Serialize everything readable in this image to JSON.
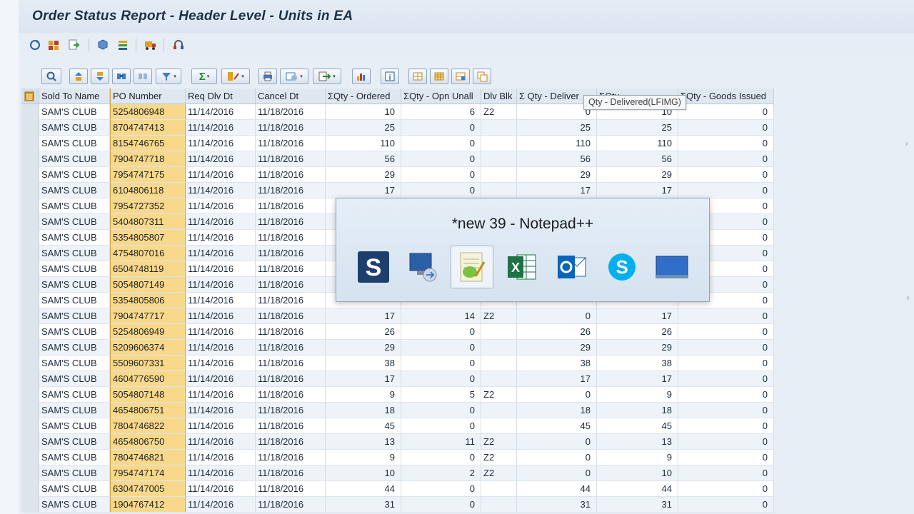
{
  "title": "Order Status Report - Header Level  - Units in EA",
  "app_toolbar_icons": [
    "refresh-icon",
    "chart-icon",
    "export-icon",
    "cube-icon",
    "layers-icon",
    "transport-icon",
    "headset-icon"
  ],
  "alv_toolbar_icons": [
    "details-icon",
    "sort-ascending-icon",
    "sort-descending-icon",
    "find-icon",
    "find-next-icon",
    "filter-icon",
    "sum-icon",
    "subtotal-icon",
    "print-icon",
    "views-icon",
    "export-icon",
    "chart-icon",
    "info-icon",
    "layout-select-icon",
    "layout-grid-icon",
    "layout-save-icon",
    "layout-manage-icon"
  ],
  "columns": [
    "Sold To Name",
    "PO Number",
    "Req Dlv Dt",
    "Cancel Dt",
    "ΣQty - Ordered",
    "ΣQty - Opn Unall",
    "Dlv Blk",
    "Σ Qty - Deliver",
    "ΣQty - ...",
    "ΣQty - Goods Issued"
  ],
  "rows": [
    {
      "sold_to": "SAM'S CLUB",
      "po": "5254806948",
      "req": "11/14/2016",
      "cancel": "11/18/2016",
      "ordered": "10",
      "open": "6",
      "blk": "Z2",
      "delivered": "0",
      "col9": "10",
      "gi": "0"
    },
    {
      "sold_to": "SAM'S CLUB",
      "po": "8704747413",
      "req": "11/14/2016",
      "cancel": "11/18/2016",
      "ordered": "25",
      "open": "0",
      "blk": "",
      "delivered": "25",
      "col9": "25",
      "gi": "0"
    },
    {
      "sold_to": "SAM'S CLUB",
      "po": "8154746765",
      "req": "11/14/2016",
      "cancel": "11/18/2016",
      "ordered": "110",
      "open": "0",
      "blk": "",
      "delivered": "110",
      "col9": "110",
      "gi": "0"
    },
    {
      "sold_to": "SAM'S CLUB",
      "po": "7904747718",
      "req": "11/14/2016",
      "cancel": "11/18/2016",
      "ordered": "56",
      "open": "0",
      "blk": "",
      "delivered": "56",
      "col9": "56",
      "gi": "0"
    },
    {
      "sold_to": "SAM'S CLUB",
      "po": "7954747175",
      "req": "11/14/2016",
      "cancel": "11/18/2016",
      "ordered": "29",
      "open": "0",
      "blk": "",
      "delivered": "29",
      "col9": "29",
      "gi": "0"
    },
    {
      "sold_to": "SAM'S CLUB",
      "po": "6104806118",
      "req": "11/14/2016",
      "cancel": "11/18/2016",
      "ordered": "17",
      "open": "0",
      "blk": "",
      "delivered": "17",
      "col9": "17",
      "gi": "0"
    },
    {
      "sold_to": "SAM'S CLUB",
      "po": "7954727352",
      "req": "11/14/2016",
      "cancel": "11/18/2016",
      "ordered": "",
      "open": "",
      "blk": "",
      "delivered": "",
      "col9": "",
      "gi": "0"
    },
    {
      "sold_to": "SAM'S CLUB",
      "po": "5404807311",
      "req": "11/14/2016",
      "cancel": "11/18/2016",
      "ordered": "",
      "open": "",
      "blk": "",
      "delivered": "",
      "col9": "",
      "gi": "0"
    },
    {
      "sold_to": "SAM'S CLUB",
      "po": "5354805807",
      "req": "11/14/2016",
      "cancel": "11/18/2016",
      "ordered": "",
      "open": "",
      "blk": "",
      "delivered": "",
      "col9": "",
      "gi": "0"
    },
    {
      "sold_to": "SAM'S CLUB",
      "po": "4754807016",
      "req": "11/14/2016",
      "cancel": "11/18/2016",
      "ordered": "",
      "open": "",
      "blk": "",
      "delivered": "",
      "col9": "",
      "gi": "0"
    },
    {
      "sold_to": "SAM'S CLUB",
      "po": "6504748119",
      "req": "11/14/2016",
      "cancel": "11/18/2016",
      "ordered": "",
      "open": "",
      "blk": "",
      "delivered": "",
      "col9": "",
      "gi": "0"
    },
    {
      "sold_to": "SAM'S CLUB",
      "po": "5054807149",
      "req": "11/14/2016",
      "cancel": "11/18/2016",
      "ordered": "",
      "open": "",
      "blk": "",
      "delivered": "",
      "col9": "",
      "gi": "0"
    },
    {
      "sold_to": "SAM'S CLUB",
      "po": "5354805806",
      "req": "11/14/2016",
      "cancel": "11/18/2016",
      "ordered": "",
      "open": "",
      "blk": "",
      "delivered": "",
      "col9": "",
      "gi": "0"
    },
    {
      "sold_to": "SAM'S CLUB",
      "po": "7904747717",
      "req": "11/14/2016",
      "cancel": "11/18/2016",
      "ordered": "17",
      "open": "14",
      "blk": "Z2",
      "delivered": "0",
      "col9": "17",
      "gi": "0"
    },
    {
      "sold_to": "SAM'S CLUB",
      "po": "5254806949",
      "req": "11/14/2016",
      "cancel": "11/18/2016",
      "ordered": "26",
      "open": "0",
      "blk": "",
      "delivered": "26",
      "col9": "26",
      "gi": "0"
    },
    {
      "sold_to": "SAM'S CLUB",
      "po": "5209606374",
      "req": "11/14/2016",
      "cancel": "11/18/2016",
      "ordered": "29",
      "open": "0",
      "blk": "",
      "delivered": "29",
      "col9": "29",
      "gi": "0"
    },
    {
      "sold_to": "SAM'S CLUB",
      "po": "5509607331",
      "req": "11/14/2016",
      "cancel": "11/18/2016",
      "ordered": "38",
      "open": "0",
      "blk": "",
      "delivered": "38",
      "col9": "38",
      "gi": "0"
    },
    {
      "sold_to": "SAM'S CLUB",
      "po": "4604776590",
      "req": "11/14/2016",
      "cancel": "11/18/2016",
      "ordered": "17",
      "open": "0",
      "blk": "",
      "delivered": "17",
      "col9": "17",
      "gi": "0"
    },
    {
      "sold_to": "SAM'S CLUB",
      "po": "5054807148",
      "req": "11/14/2016",
      "cancel": "11/18/2016",
      "ordered": "9",
      "open": "5",
      "blk": "Z2",
      "delivered": "0",
      "col9": "9",
      "gi": "0"
    },
    {
      "sold_to": "SAM'S CLUB",
      "po": "4654806751",
      "req": "11/14/2016",
      "cancel": "11/18/2016",
      "ordered": "18",
      "open": "0",
      "blk": "",
      "delivered": "18",
      "col9": "18",
      "gi": "0"
    },
    {
      "sold_to": "SAM'S CLUB",
      "po": "7804746822",
      "req": "11/14/2016",
      "cancel": "11/18/2016",
      "ordered": "45",
      "open": "0",
      "blk": "",
      "delivered": "45",
      "col9": "45",
      "gi": "0"
    },
    {
      "sold_to": "SAM'S CLUB",
      "po": "4654806750",
      "req": "11/14/2016",
      "cancel": "11/18/2016",
      "ordered": "13",
      "open": "11",
      "blk": "Z2",
      "delivered": "0",
      "col9": "13",
      "gi": "0"
    },
    {
      "sold_to": "SAM'S CLUB",
      "po": "7804746821",
      "req": "11/14/2016",
      "cancel": "11/18/2016",
      "ordered": "9",
      "open": "0",
      "blk": "Z2",
      "delivered": "0",
      "col9": "9",
      "gi": "0"
    },
    {
      "sold_to": "SAM'S CLUB",
      "po": "7954747174",
      "req": "11/14/2016",
      "cancel": "11/18/2016",
      "ordered": "10",
      "open": "2",
      "blk": "Z2",
      "delivered": "0",
      "col9": "10",
      "gi": "0"
    },
    {
      "sold_to": "SAM'S CLUB",
      "po": "6304747005",
      "req": "11/14/2016",
      "cancel": "11/18/2016",
      "ordered": "44",
      "open": "0",
      "blk": "",
      "delivered": "44",
      "col9": "44",
      "gi": "0"
    },
    {
      "sold_to": "SAM'S CLUB",
      "po": "1904767412",
      "req": "11/14/2016",
      "cancel": "11/18/2016",
      "ordered": "31",
      "open": "0",
      "blk": "",
      "delivered": "31",
      "col9": "31",
      "gi": "0"
    }
  ],
  "tooltip": "Qty - Delivered(LFIMG)",
  "task_switcher": {
    "title": "*new 39 - Notepad++",
    "apps": [
      "snagit-editor-icon",
      "remote-desktop-icon",
      "notepad-plus-plus-icon",
      "excel-icon",
      "outlook-icon",
      "skype-icon",
      "desktop-icon"
    ],
    "active_index": 2
  },
  "colors": {
    "po_highlight": "#f8d98c",
    "header_bg": "#dfe7f1",
    "accent": "#1e3047"
  }
}
